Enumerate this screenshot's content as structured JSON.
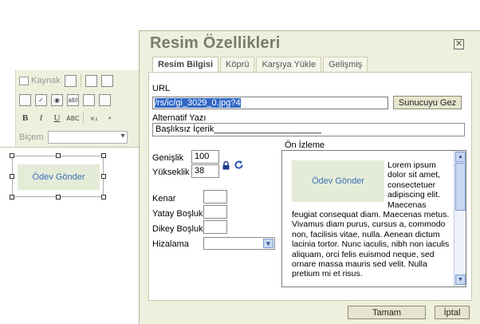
{
  "editor": {
    "toolbar": {
      "source_label": "Kaynak",
      "style_label": "Biçem",
      "subscript_label": "×₂",
      "superscript_label": "ײ",
      "bold_label": "B",
      "italic_label": "I",
      "underline_label": "U",
      "strike_label": "ABC",
      "field_label": "abl"
    },
    "preview_button_text": "Ödev Gönder"
  },
  "dialog": {
    "title": "Resim Özellikleri",
    "close_icon": "close-icon",
    "tabs": [
      {
        "label": "Resim Bilgisi",
        "active": true
      },
      {
        "label": "Köprü",
        "active": false
      },
      {
        "label": "Karşıya Yükle",
        "active": false
      },
      {
        "label": "Gelişmiş",
        "active": false
      }
    ],
    "url_label": "URL",
    "url_value": "/rs/ic/gi_3029_0.jpg?4",
    "browse_server_label": "Sunucuyu Gez",
    "alt_label": "Alternatif Yazı",
    "alt_value": "Başlıksız İçerik______________________",
    "width_label": "Genişlik",
    "width_value": "100",
    "height_label": "Yükseklik",
    "height_value": "38",
    "border_label": "Kenar",
    "border_value": "",
    "hspace_label": "Yatay Boşluk",
    "hspace_value": "",
    "vspace_label": "Dikey Boşluk",
    "vspace_value": "",
    "align_label": "Hizalama",
    "align_value": "",
    "preview_label": "Ön İzleme",
    "preview_image_text": "Ödev Gönder",
    "preview_text": "Lorem ipsum dolor sit amet, consectetuer adipiscing elit. Maecenas feugiat consequat diam. Maecenas metus. Vivamus diam purus, cursus a, commodo non, facilisis vitae, nulla. Aenean dictum lacinia tortor. Nunc iaculis, nibh non iaculis aliquam, orci felis euismod neque, sed ornare massa mauris sed velit. Nulla pretium mi et risus.",
    "ok_label": "Tamam",
    "cancel_label": "İptal"
  }
}
